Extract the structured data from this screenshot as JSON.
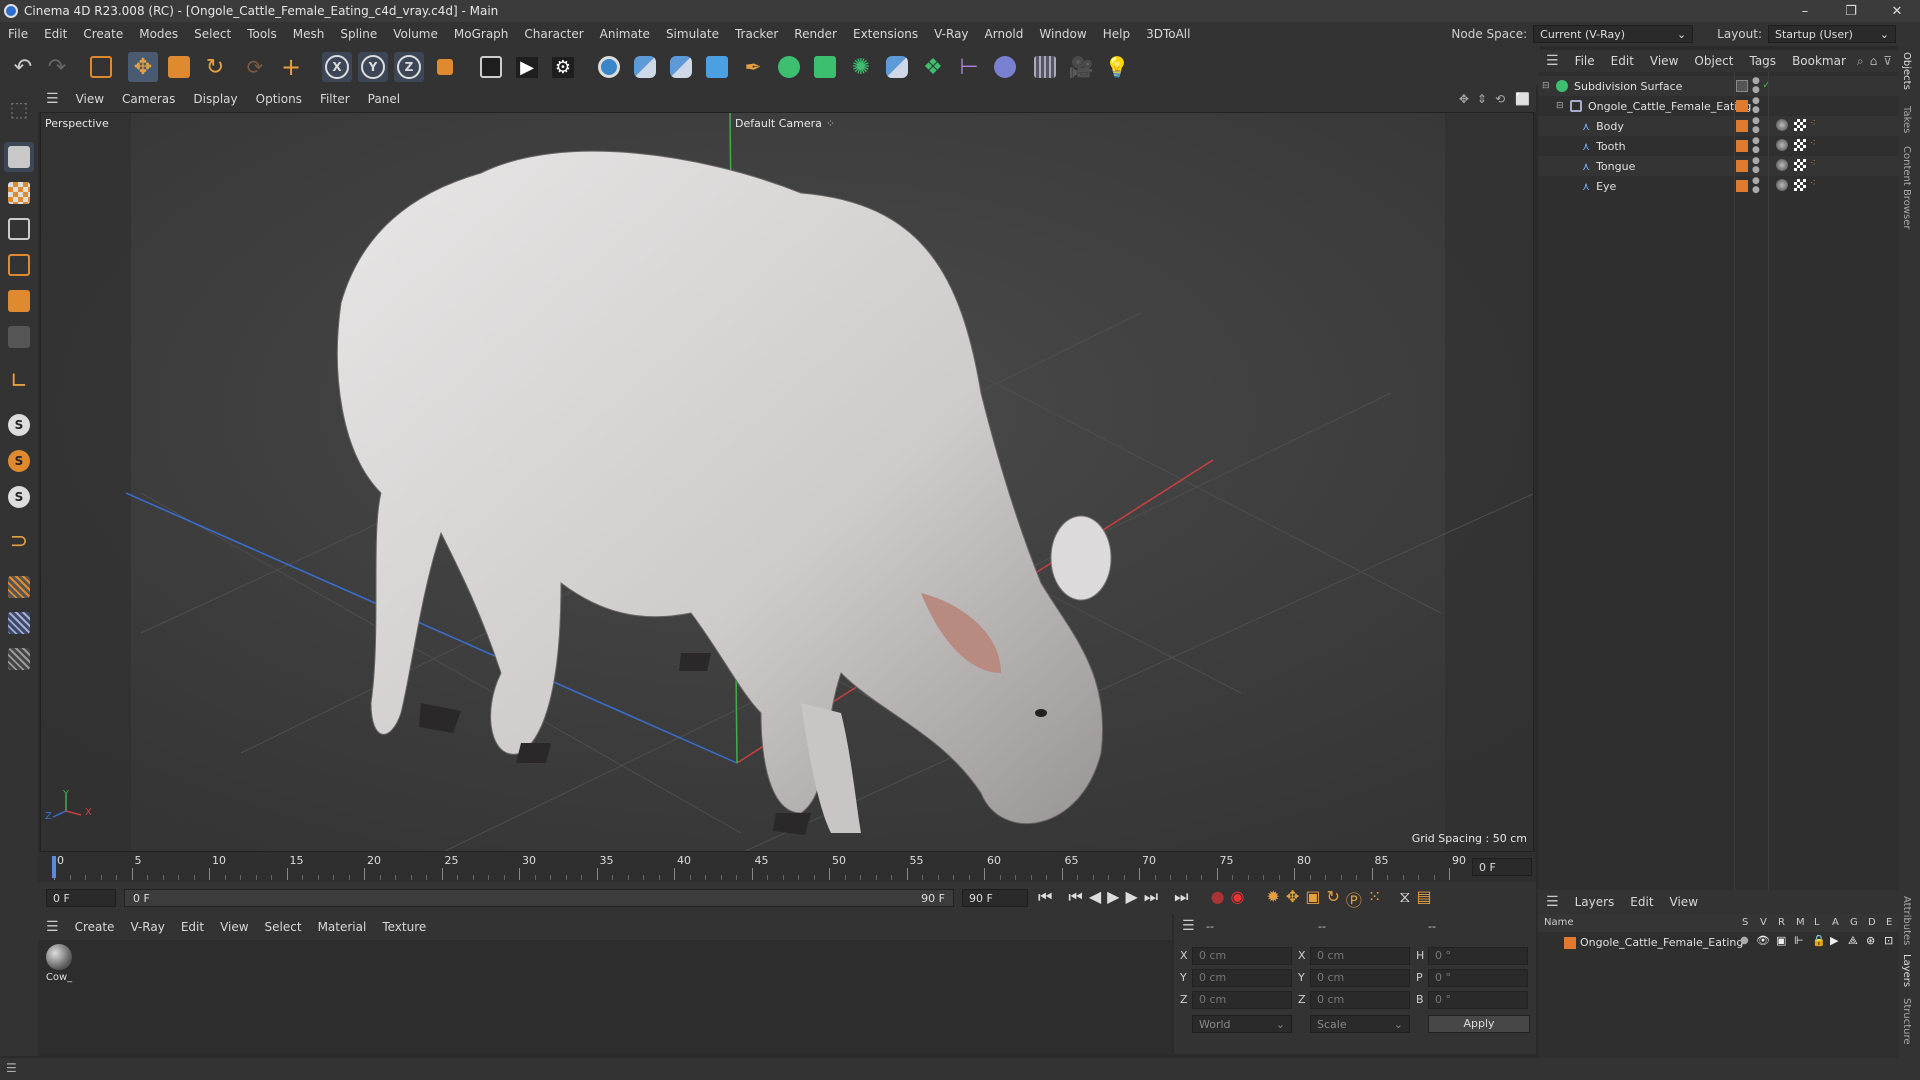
{
  "window": {
    "title": "Cinema 4D R23.008 (RC) - [Ongole_Cattle_Female_Eating_c4d_vray.c4d] - Main",
    "minimize": "–",
    "restore": "❐",
    "close": "✕"
  },
  "menubar": {
    "items": [
      "File",
      "Edit",
      "Create",
      "Modes",
      "Select",
      "Tools",
      "Mesh",
      "Spline",
      "Volume",
      "MoGraph",
      "Character",
      "Animate",
      "Simulate",
      "Tracker",
      "Render",
      "Extensions",
      "V-Ray",
      "Arnold",
      "Window",
      "Help",
      "3DToAll"
    ],
    "node_space_label": "Node Space:",
    "node_space_value": "Current (V-Ray)",
    "layout_label": "Layout:",
    "layout_value": "Startup (User)"
  },
  "toolbar": {
    "axis_x": "X",
    "axis_y": "Y",
    "axis_z": "Z"
  },
  "viewport": {
    "menu": [
      "View",
      "Cameras",
      "Display",
      "Options",
      "Filter",
      "Panel"
    ],
    "view_name": "Perspective",
    "camera_label": "Default Camera",
    "grid_spacing": "Grid Spacing : 50 cm",
    "axis_y": "Y",
    "axis_x": "X",
    "axis_z": "Z"
  },
  "timeline": {
    "ticks": [
      "0",
      "5",
      "10",
      "15",
      "20",
      "25",
      "30",
      "35",
      "40",
      "45",
      "50",
      "55",
      "60",
      "65",
      "70",
      "75",
      "80",
      "85",
      "90"
    ],
    "frame_field": "0 F"
  },
  "transport": {
    "start_field": "0 F",
    "range_start": "0 F",
    "range_end": "90 F",
    "end_field": "90 F"
  },
  "material_manager": {
    "menu": [
      "Create",
      "V-Ray",
      "Edit",
      "View",
      "Select",
      "Material",
      "Texture"
    ],
    "materials": [
      {
        "name": "Cow_"
      }
    ]
  },
  "coordinates": {
    "header1": "--",
    "header2": "--",
    "header3": "--",
    "x_label": "X",
    "y_label": "Y",
    "z_label": "Z",
    "x2_label": "X",
    "y2_label": "Y",
    "z2_label": "Z",
    "h_label": "H",
    "p_label": "P",
    "b_label": "B",
    "pos_x": "0 cm",
    "pos_y": "0 cm",
    "pos_z": "0 cm",
    "size_x": "0 cm",
    "size_y": "0 cm",
    "size_z": "0 cm",
    "rot_h": "0 °",
    "rot_p": "0 °",
    "rot_b": "0 °",
    "mode_world": "World",
    "mode_scale": "Scale",
    "apply": "Apply"
  },
  "object_manager": {
    "menu": [
      "File",
      "Edit",
      "View",
      "Object",
      "Tags",
      "Bookmar"
    ],
    "objects": [
      {
        "name": "Subdivision Surface",
        "level": 0
      },
      {
        "name": "Ongole_Cattle_Female_Eating",
        "level": 1
      },
      {
        "name": "Body",
        "level": 2
      },
      {
        "name": "Tooth",
        "level": 2
      },
      {
        "name": "Tongue",
        "level": 2
      },
      {
        "name": "Eye",
        "level": 2
      }
    ]
  },
  "layer_manager": {
    "menu": [
      "Layers",
      "Edit",
      "View"
    ],
    "header_name": "Name",
    "header_cols": [
      "S",
      "V",
      "R",
      "M",
      "L",
      "A",
      "G",
      "D",
      "E"
    ],
    "layers": [
      {
        "name": "Ongole_Cattle_Female_Eating"
      }
    ]
  },
  "side_tabs": {
    "objects": "Objects",
    "takes": "Takes",
    "content_browser": "Content Browser",
    "attributes": "Attributes",
    "layers": "Layers",
    "structure": "Structure"
  },
  "colors": {
    "accent_orange": "#e07a2e",
    "axis_red": "#c84040",
    "axis_green": "#3fae4a",
    "axis_blue": "#3a6ed0"
  }
}
